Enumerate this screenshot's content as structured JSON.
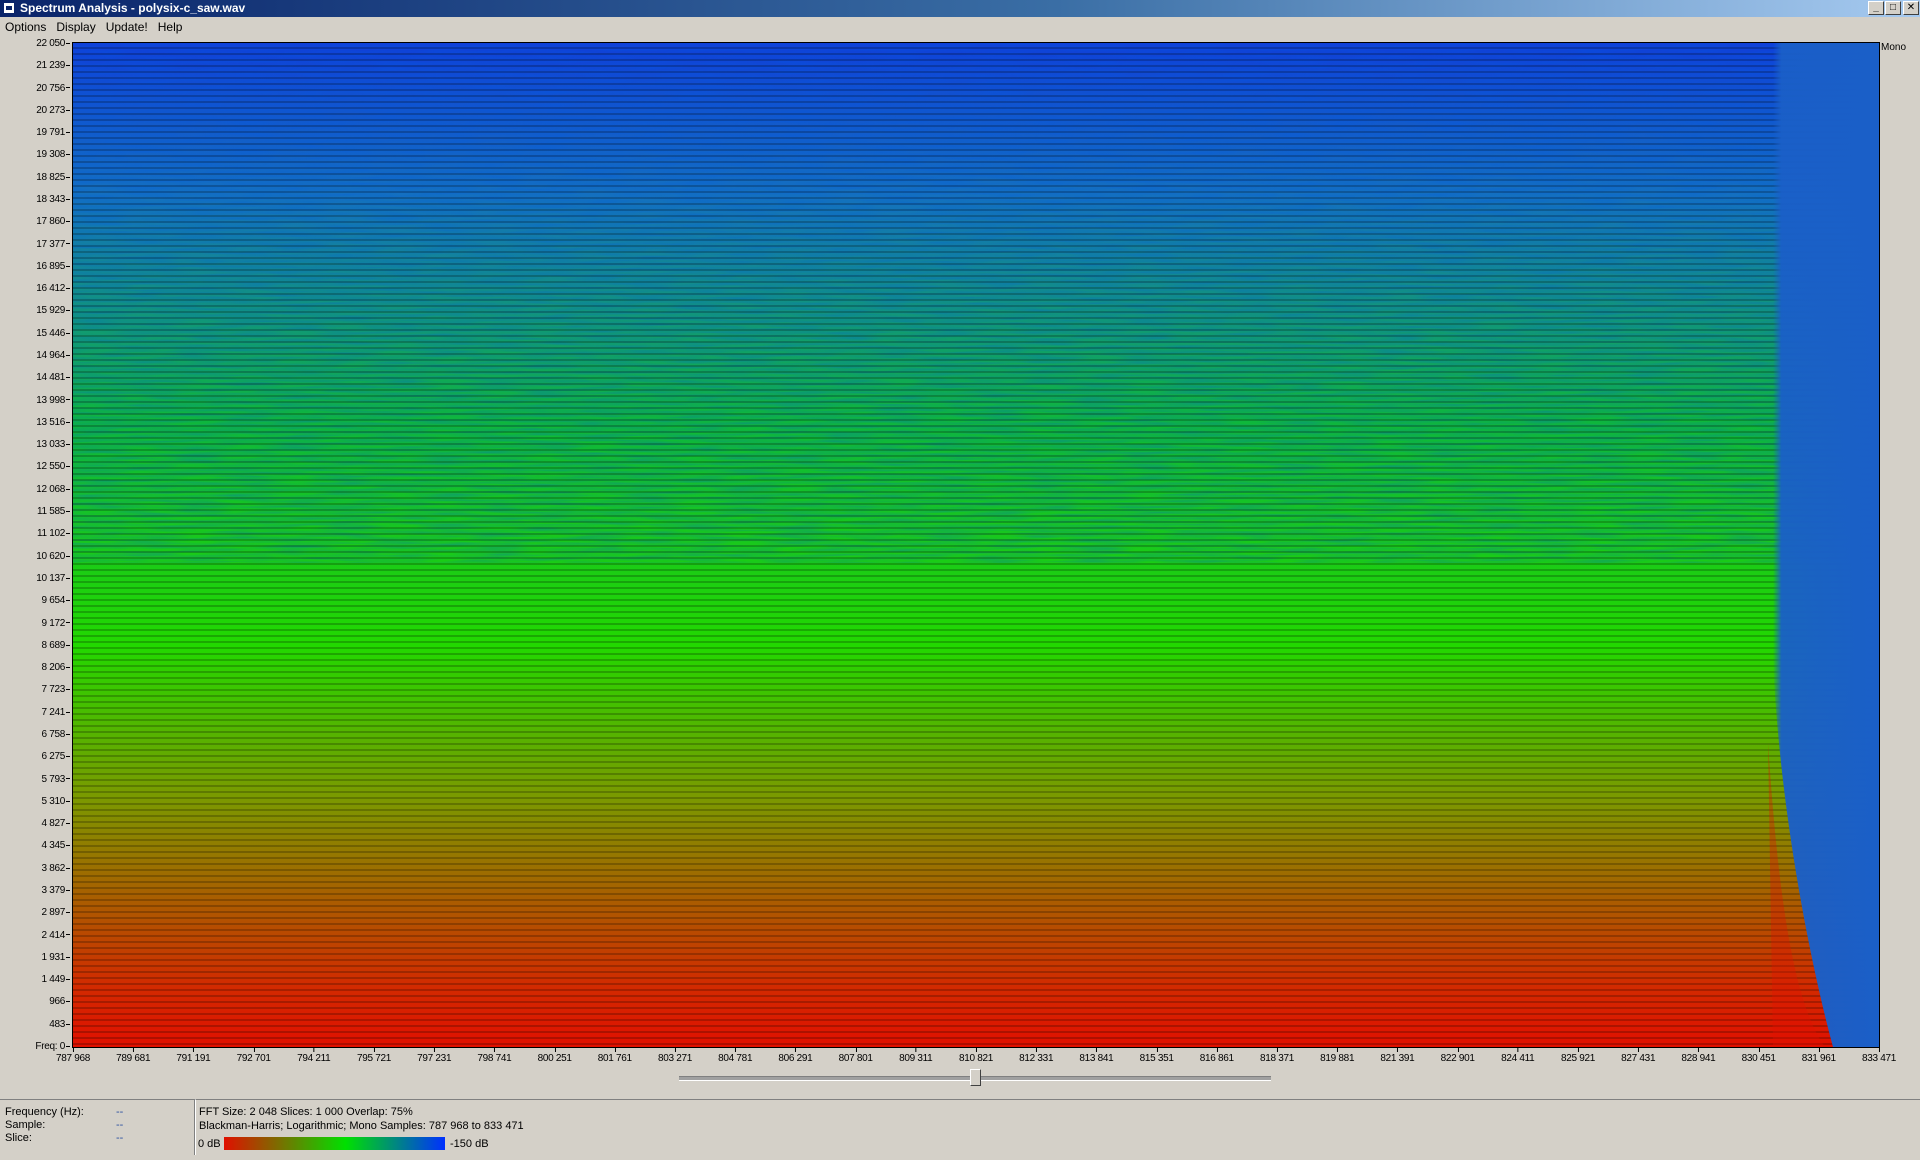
{
  "window": {
    "title": "Spectrum Analysis - polysix-c_saw.wav",
    "buttons": {
      "minimize": "_",
      "maximize": "□",
      "close": "✕"
    }
  },
  "menu": [
    "Options",
    "Display",
    "Update!",
    "Help"
  ],
  "y_axis": {
    "ticks": [
      "22 050",
      "21 239",
      "20 756",
      "20 273",
      "19 791",
      "19 308",
      "18 825",
      "18 343",
      "17 860",
      "17 377",
      "16 895",
      "16 412",
      "15 929",
      "15 446",
      "14 964",
      "14 481",
      "13 998",
      "13 516",
      "13 033",
      "12 550",
      "12 068",
      "11 585",
      "11 102",
      "10 620",
      "10 137",
      "9 654",
      "9 172",
      "8 689",
      "8 206",
      "7 723",
      "7 241",
      "6 758",
      "6 275",
      "5 793",
      "5 310",
      "4 827",
      "4 345",
      "3 862",
      "3 379",
      "2 897",
      "2 414",
      "1 931",
      "1 449",
      "966",
      "483",
      "Freq: 0"
    ]
  },
  "x_axis": {
    "ticks": [
      "787 968",
      "789 681",
      "791 191",
      "792 701",
      "794 211",
      "795 721",
      "797 231",
      "798 741",
      "800 251",
      "801 761",
      "803 271",
      "804 781",
      "806 291",
      "807 801",
      "809 311",
      "810 821",
      "812 331",
      "813 841",
      "815 351",
      "816 861",
      "818 371",
      "819 881",
      "821 391",
      "822 901",
      "824 411",
      "825 921",
      "827 431",
      "828 941",
      "830 451",
      "831 961",
      "833 471"
    ]
  },
  "channel_label": "Mono",
  "scroll": {
    "position": 0.5
  },
  "status": {
    "frequency_label": "Frequency (Hz):",
    "frequency_value": "--",
    "sample_label": "Sample:",
    "sample_value": "--",
    "slice_label": "Slice:",
    "slice_value": "--"
  },
  "info": {
    "line1": "FFT Size: 2 048  Slices: 1 000  Overlap: 75%",
    "line2": "Blackman-Harris; Logarithmic; Mono  Samples: 787 968 to 833 471",
    "legend_min": "0 dB",
    "legend_max": "-150 dB"
  },
  "colors": {
    "hot": "#e01000",
    "mid": "#00e000",
    "cold": "#0030ff",
    "titlebar_start": "#0a246a",
    "titlebar_end": "#a6caf0",
    "background": "#d4d0c8"
  }
}
